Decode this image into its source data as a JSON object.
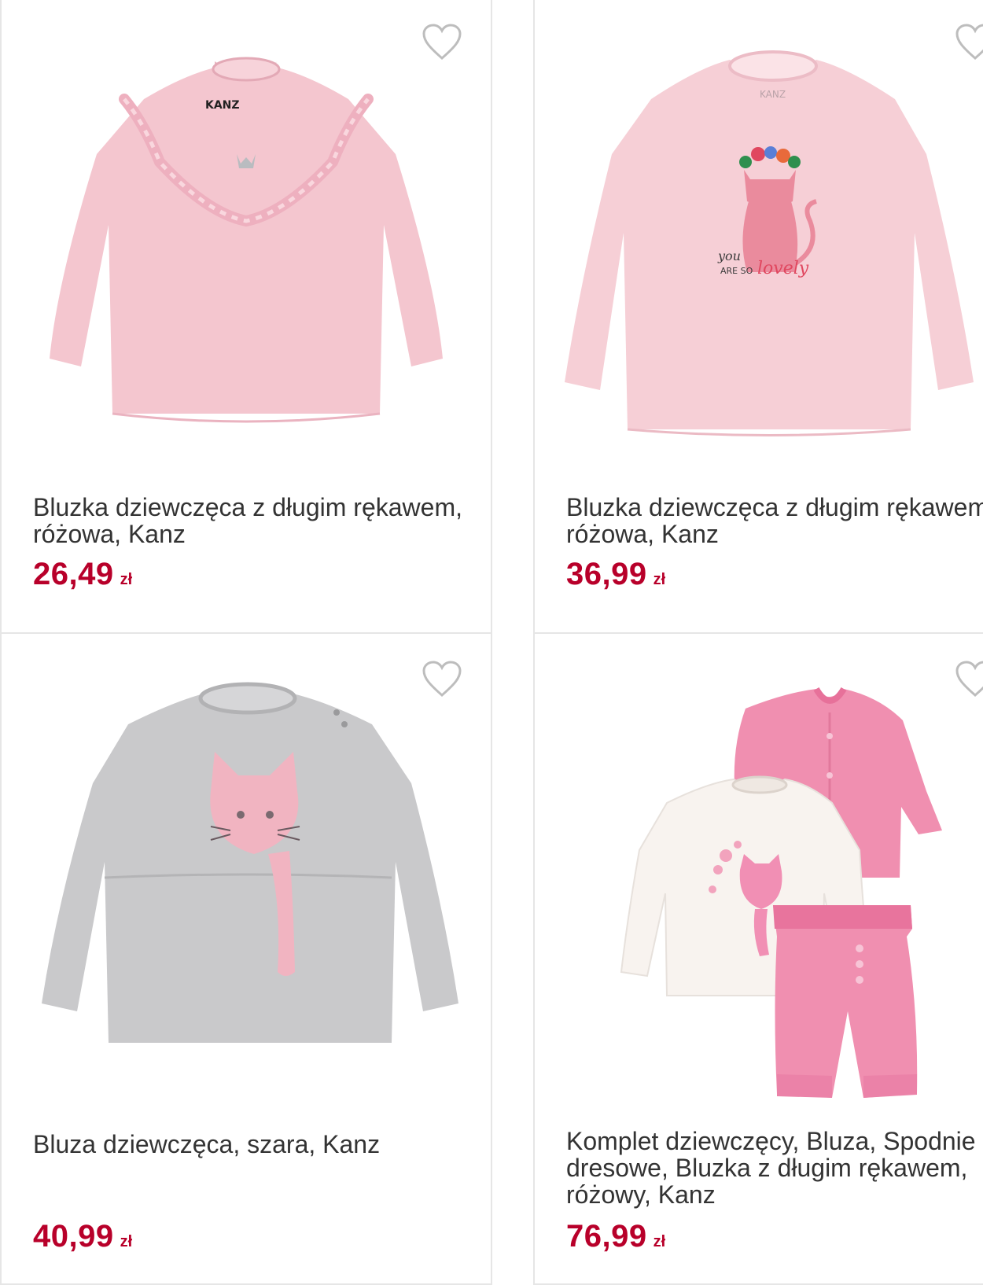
{
  "products": [
    {
      "title": "Bluzka dziewczęca z długim rękawem, różowa, Kanz",
      "price": "26,49",
      "currency": "zł",
      "wishlist_icon": "heart-outline-icon",
      "image": "pink-long-sleeve-blouse-with-ruffle"
    },
    {
      "title": "Bluzka dziewczęca z długim rękawem, różowa, Kanz",
      "price": "36,99",
      "currency": "zł",
      "wishlist_icon": "heart-outline-icon",
      "image": "pink-long-sleeve-blouse-with-cat-print"
    },
    {
      "title": "Bluza dziewczęca, szara, Kanz",
      "price": "40,99",
      "currency": "zł",
      "wishlist_icon": "heart-outline-icon",
      "image": "grey-sweatshirt-with-pink-cat"
    },
    {
      "title": "Komplet dziewczęcy, Bluza, Spodnie dresowe, Bluzka z długim rękawem, różowy, Kanz",
      "price": "76,99",
      "currency": "zł",
      "wishlist_icon": "heart-outline-icon",
      "image": "pink-set-jacket-pants-white-top"
    }
  ],
  "colors": {
    "price": "#b8002a",
    "title": "#333333",
    "border": "#e6e6e6",
    "heart": "#bdbdbd"
  },
  "print_text": {
    "brand_label": "KANZ",
    "cat_print_line1": "you",
    "cat_print_line2": "ARE SO",
    "cat_print_line3": "lovely"
  }
}
